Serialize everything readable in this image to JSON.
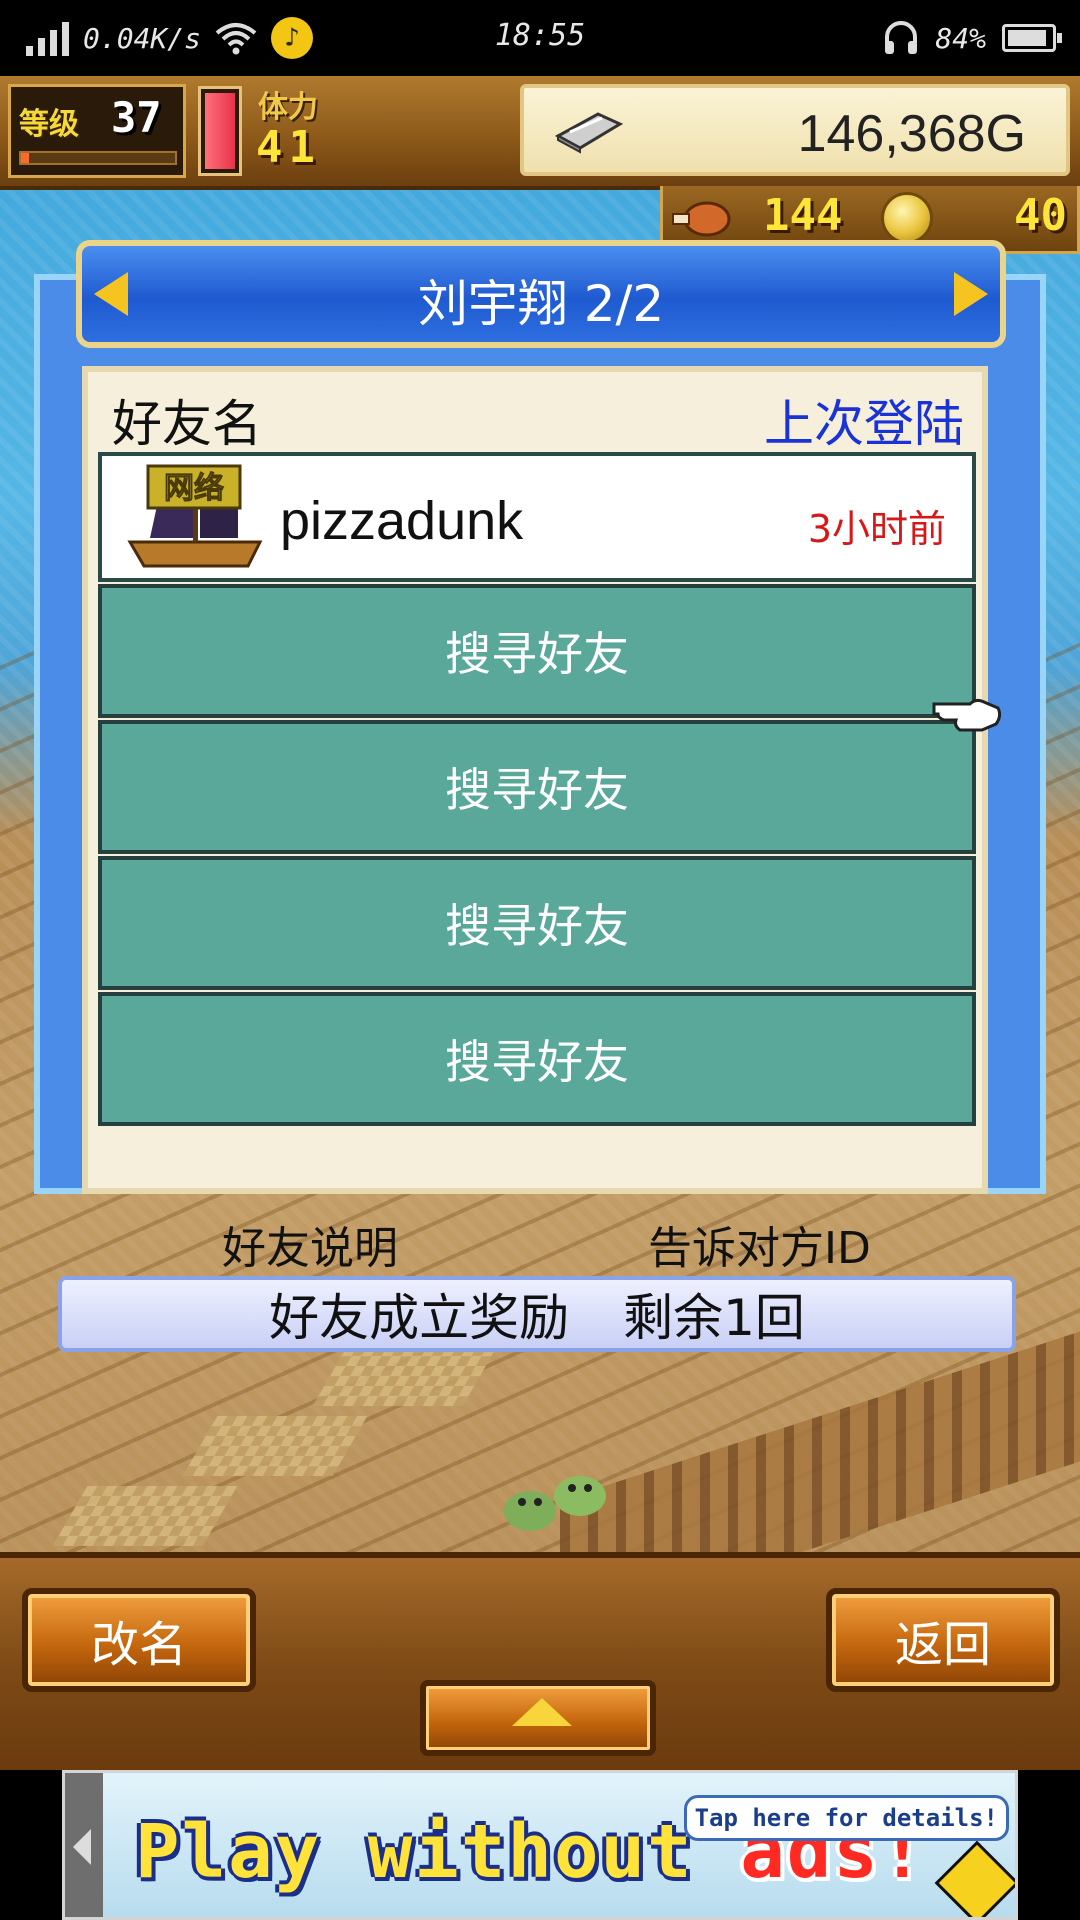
{
  "status_bar": {
    "net_speed": "0.04K/s",
    "time": "18:55",
    "battery": "84%",
    "battery_level": 0.84,
    "icons": [
      "signal-icon",
      "wifi-icon",
      "music-app-icon",
      "headset-icon",
      "battery-icon"
    ]
  },
  "hud": {
    "level_label": "等级",
    "level_value": "37",
    "exp_level": 0.05,
    "stamina_label": "体力",
    "stamina_value": "41",
    "stamina_level": 1.0,
    "gold": "146,368G",
    "food": "144",
    "medals": "40"
  },
  "dialog": {
    "title": "刘宇翔 2/2",
    "col_name": "好友名",
    "col_last_login": "上次登陆",
    "friends": [
      {
        "name": "pizzadunk",
        "last_login": "3小时前",
        "badge": "网络"
      }
    ],
    "search_slots": [
      "搜寻好友",
      "搜寻好友",
      "搜寻好友",
      "搜寻好友"
    ],
    "info_link": "好友说明",
    "id_link": "告诉对方ID"
  },
  "reward": {
    "label": "好友成立奖励",
    "remaining": "剩余1回"
  },
  "bottom": {
    "rename_label": "改名",
    "back_label": "返回"
  },
  "ad": {
    "text_main": "Play without ",
    "text_red": "ads!",
    "details": "Tap here for details!"
  },
  "colors": {
    "dialog_bg": "#4a8ce8",
    "slot_bg": "#5aa89a",
    "last_login_blue": "#1a33d6",
    "time_red": "#d81818"
  }
}
